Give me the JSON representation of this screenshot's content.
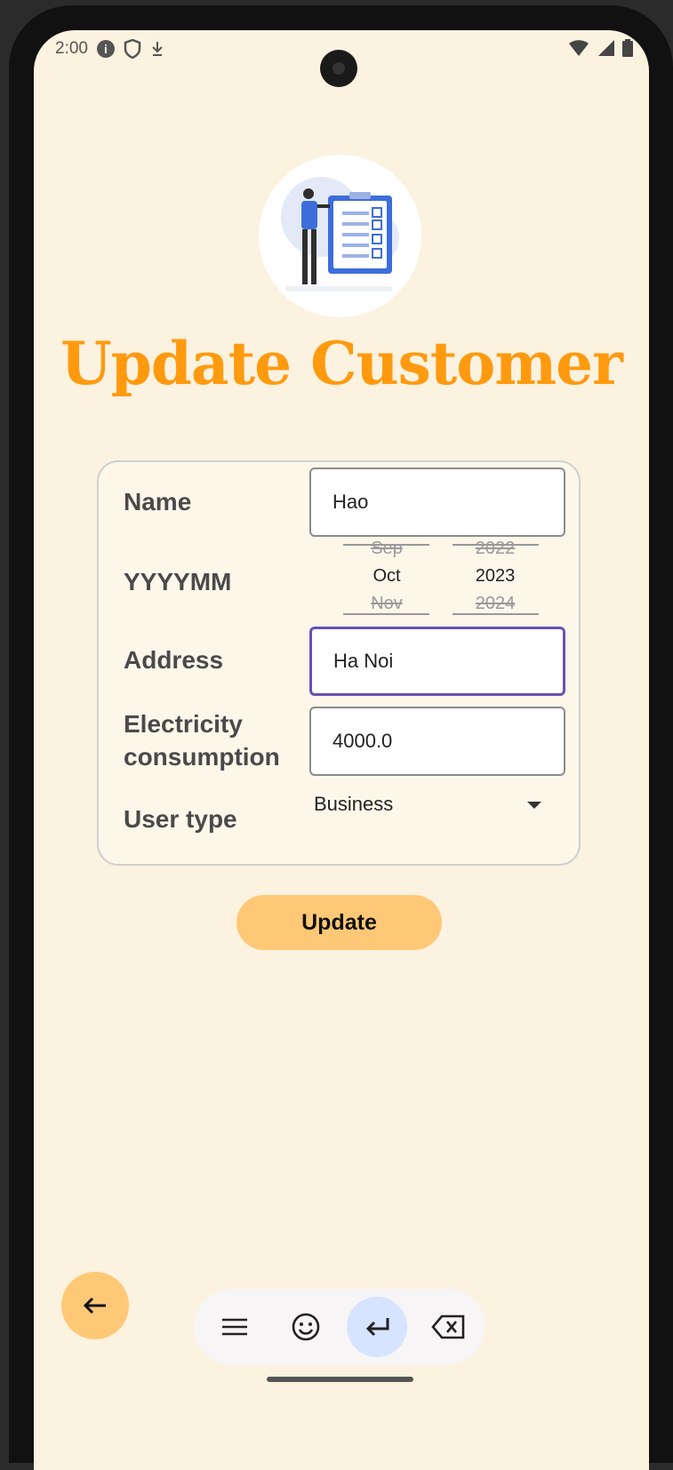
{
  "status_bar": {
    "time": "2:00"
  },
  "page": {
    "title": "Update Customer"
  },
  "form": {
    "name_label": "Name",
    "name_value": "Hao",
    "date_label": "YYYYMM",
    "month_prev": "Sep",
    "month_selected": "Oct",
    "month_next": "Nov",
    "year_prev": "2022",
    "year_selected": "2023",
    "year_next": "2024",
    "address_label": "Address",
    "address_value": "Ha Noi",
    "consumption_label_1": "Electricity",
    "consumption_label_2": "consumption",
    "consumption_value": "4000.0",
    "user_type_label": "User type",
    "user_type_value": "Business"
  },
  "actions": {
    "update_label": "Update"
  },
  "colors": {
    "accent": "#ff9a0f",
    "button": "#ffc876",
    "background": "#fbf2e0",
    "focus": "#6a4fb5"
  },
  "icons": [
    "info-icon",
    "shield-icon",
    "download-icon",
    "wifi-icon",
    "signal-icon",
    "battery-icon",
    "back-arrow-icon",
    "menu-icon",
    "emoji-icon",
    "enter-icon",
    "backspace-icon"
  ]
}
